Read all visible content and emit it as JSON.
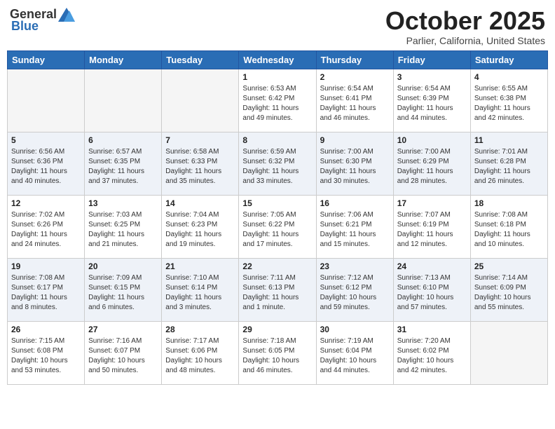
{
  "header": {
    "logo_general": "General",
    "logo_blue": "Blue",
    "month": "October 2025",
    "location": "Parlier, California, United States"
  },
  "days_of_week": [
    "Sunday",
    "Monday",
    "Tuesday",
    "Wednesday",
    "Thursday",
    "Friday",
    "Saturday"
  ],
  "weeks": [
    [
      {
        "day": "",
        "info": ""
      },
      {
        "day": "",
        "info": ""
      },
      {
        "day": "",
        "info": ""
      },
      {
        "day": "1",
        "info": "Sunrise: 6:53 AM\nSunset: 6:42 PM\nDaylight: 11 hours\nand 49 minutes."
      },
      {
        "day": "2",
        "info": "Sunrise: 6:54 AM\nSunset: 6:41 PM\nDaylight: 11 hours\nand 46 minutes."
      },
      {
        "day": "3",
        "info": "Sunrise: 6:54 AM\nSunset: 6:39 PM\nDaylight: 11 hours\nand 44 minutes."
      },
      {
        "day": "4",
        "info": "Sunrise: 6:55 AM\nSunset: 6:38 PM\nDaylight: 11 hours\nand 42 minutes."
      }
    ],
    [
      {
        "day": "5",
        "info": "Sunrise: 6:56 AM\nSunset: 6:36 PM\nDaylight: 11 hours\nand 40 minutes."
      },
      {
        "day": "6",
        "info": "Sunrise: 6:57 AM\nSunset: 6:35 PM\nDaylight: 11 hours\nand 37 minutes."
      },
      {
        "day": "7",
        "info": "Sunrise: 6:58 AM\nSunset: 6:33 PM\nDaylight: 11 hours\nand 35 minutes."
      },
      {
        "day": "8",
        "info": "Sunrise: 6:59 AM\nSunset: 6:32 PM\nDaylight: 11 hours\nand 33 minutes."
      },
      {
        "day": "9",
        "info": "Sunrise: 7:00 AM\nSunset: 6:30 PM\nDaylight: 11 hours\nand 30 minutes."
      },
      {
        "day": "10",
        "info": "Sunrise: 7:00 AM\nSunset: 6:29 PM\nDaylight: 11 hours\nand 28 minutes."
      },
      {
        "day": "11",
        "info": "Sunrise: 7:01 AM\nSunset: 6:28 PM\nDaylight: 11 hours\nand 26 minutes."
      }
    ],
    [
      {
        "day": "12",
        "info": "Sunrise: 7:02 AM\nSunset: 6:26 PM\nDaylight: 11 hours\nand 24 minutes."
      },
      {
        "day": "13",
        "info": "Sunrise: 7:03 AM\nSunset: 6:25 PM\nDaylight: 11 hours\nand 21 minutes."
      },
      {
        "day": "14",
        "info": "Sunrise: 7:04 AM\nSunset: 6:23 PM\nDaylight: 11 hours\nand 19 minutes."
      },
      {
        "day": "15",
        "info": "Sunrise: 7:05 AM\nSunset: 6:22 PM\nDaylight: 11 hours\nand 17 minutes."
      },
      {
        "day": "16",
        "info": "Sunrise: 7:06 AM\nSunset: 6:21 PM\nDaylight: 11 hours\nand 15 minutes."
      },
      {
        "day": "17",
        "info": "Sunrise: 7:07 AM\nSunset: 6:19 PM\nDaylight: 11 hours\nand 12 minutes."
      },
      {
        "day": "18",
        "info": "Sunrise: 7:08 AM\nSunset: 6:18 PM\nDaylight: 11 hours\nand 10 minutes."
      }
    ],
    [
      {
        "day": "19",
        "info": "Sunrise: 7:08 AM\nSunset: 6:17 PM\nDaylight: 11 hours\nand 8 minutes."
      },
      {
        "day": "20",
        "info": "Sunrise: 7:09 AM\nSunset: 6:15 PM\nDaylight: 11 hours\nand 6 minutes."
      },
      {
        "day": "21",
        "info": "Sunrise: 7:10 AM\nSunset: 6:14 PM\nDaylight: 11 hours\nand 3 minutes."
      },
      {
        "day": "22",
        "info": "Sunrise: 7:11 AM\nSunset: 6:13 PM\nDaylight: 11 hours\nand 1 minute."
      },
      {
        "day": "23",
        "info": "Sunrise: 7:12 AM\nSunset: 6:12 PM\nDaylight: 10 hours\nand 59 minutes."
      },
      {
        "day": "24",
        "info": "Sunrise: 7:13 AM\nSunset: 6:10 PM\nDaylight: 10 hours\nand 57 minutes."
      },
      {
        "day": "25",
        "info": "Sunrise: 7:14 AM\nSunset: 6:09 PM\nDaylight: 10 hours\nand 55 minutes."
      }
    ],
    [
      {
        "day": "26",
        "info": "Sunrise: 7:15 AM\nSunset: 6:08 PM\nDaylight: 10 hours\nand 53 minutes."
      },
      {
        "day": "27",
        "info": "Sunrise: 7:16 AM\nSunset: 6:07 PM\nDaylight: 10 hours\nand 50 minutes."
      },
      {
        "day": "28",
        "info": "Sunrise: 7:17 AM\nSunset: 6:06 PM\nDaylight: 10 hours\nand 48 minutes."
      },
      {
        "day": "29",
        "info": "Sunrise: 7:18 AM\nSunset: 6:05 PM\nDaylight: 10 hours\nand 46 minutes."
      },
      {
        "day": "30",
        "info": "Sunrise: 7:19 AM\nSunset: 6:04 PM\nDaylight: 10 hours\nand 44 minutes."
      },
      {
        "day": "31",
        "info": "Sunrise: 7:20 AM\nSunset: 6:02 PM\nDaylight: 10 hours\nand 42 minutes."
      },
      {
        "day": "",
        "info": ""
      }
    ]
  ]
}
